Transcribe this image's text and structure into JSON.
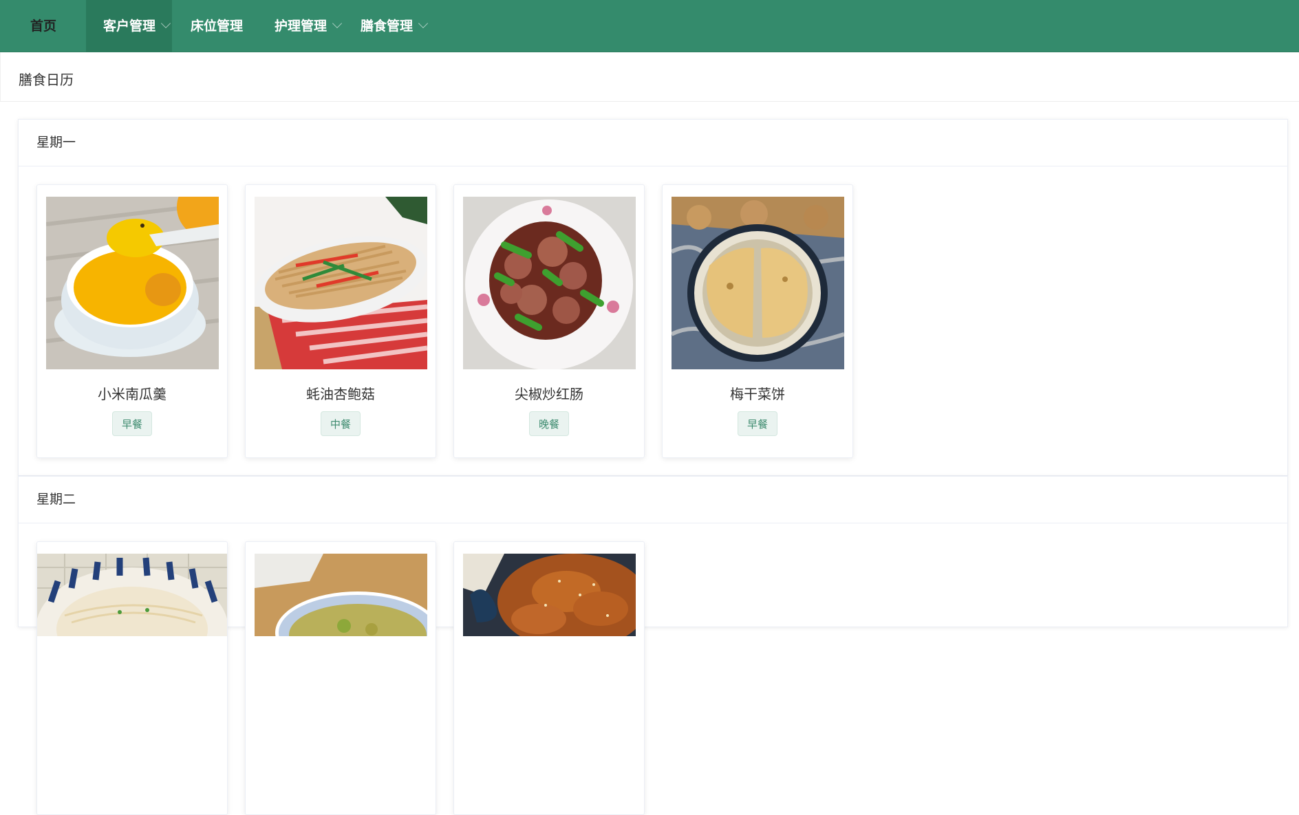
{
  "nav": {
    "items": [
      {
        "label": "首页"
      },
      {
        "label": "客户管理"
      },
      {
        "label": "床位管理"
      },
      {
        "label": "护理管理"
      },
      {
        "label": "膳食管理"
      }
    ]
  },
  "page": {
    "title": "膳食日历"
  },
  "days": [
    {
      "name": "星期一",
      "meals": [
        {
          "name": "小米南瓜羹",
          "tag": "早餐",
          "image_icon": "pumpkin-soup-image"
        },
        {
          "name": "蚝油杏鲍菇",
          "tag": "中餐",
          "image_icon": "mushroom-stirfry-image"
        },
        {
          "name": "尖椒炒红肠",
          "tag": "晚餐",
          "image_icon": "sausage-pepper-image"
        },
        {
          "name": "梅干菜饼",
          "tag": "早餐",
          "image_icon": "vegetable-pancake-image"
        }
      ]
    },
    {
      "name": "星期二",
      "meals": [
        {
          "image_icon": "noodle-bowl-image"
        },
        {
          "image_icon": "vegetable-bowl-image"
        },
        {
          "image_icon": "sesame-chicken-image"
        }
      ]
    }
  ],
  "colors": {
    "nav_bg": "#348b6c",
    "nav_active": "#2a7a5c",
    "tag_bg": "#eaf3f0",
    "tag_text": "#3e8b6f"
  }
}
